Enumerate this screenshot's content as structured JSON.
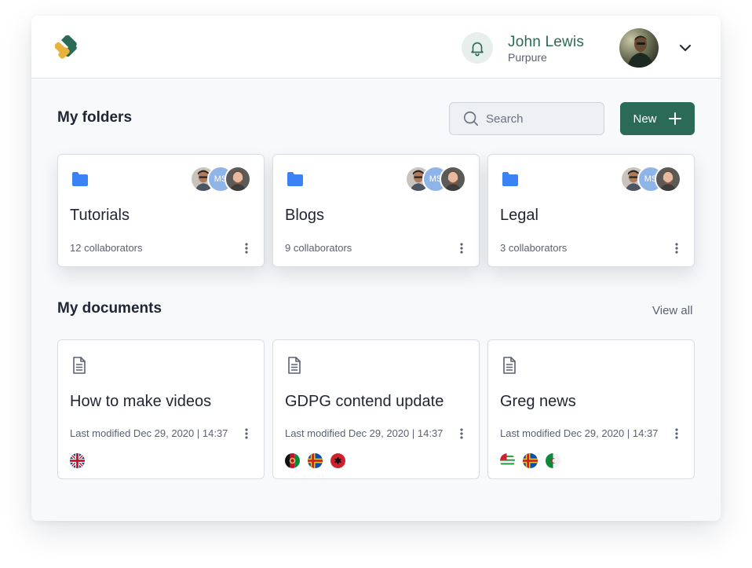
{
  "header": {
    "user_name": "John Lewis",
    "user_org": "Purpure"
  },
  "folders": {
    "title": "My folders",
    "search_placeholder": "Search",
    "new_label": "New",
    "items": [
      {
        "name": "Tutorials",
        "collaborators": "12 collaborators",
        "badge": "MS"
      },
      {
        "name": "Blogs",
        "collaborators": "9 collaborators",
        "badge": "MS"
      },
      {
        "name": "Legal",
        "collaborators": "3 collaborators",
        "badge": "MS"
      }
    ]
  },
  "documents": {
    "title": "My documents",
    "view_all": "View all",
    "items": [
      {
        "name": "How to make videos",
        "modified": "Last modified Dec 29, 2020 | 14:37",
        "flags": [
          "uk-flag-icon"
        ]
      },
      {
        "name": "GDPG contend update",
        "modified": "Last modified Dec 29, 2020 | 14:37",
        "flags": [
          "afghanistan-flag-icon",
          "aland-flag-icon",
          "albania-flag-icon"
        ]
      },
      {
        "name": "Greg news",
        "modified": "Last modified Dec 29, 2020 | 14:37",
        "flags": [
          "abkhazia-flag-icon",
          "aland-flag-icon",
          "algeria-flag-icon"
        ]
      }
    ]
  },
  "colors": {
    "accent": "#2a6a56",
    "folder_icon": "#3b82f6",
    "logo_yellow": "#e8b33a",
    "logo_green": "#2a6a56"
  }
}
